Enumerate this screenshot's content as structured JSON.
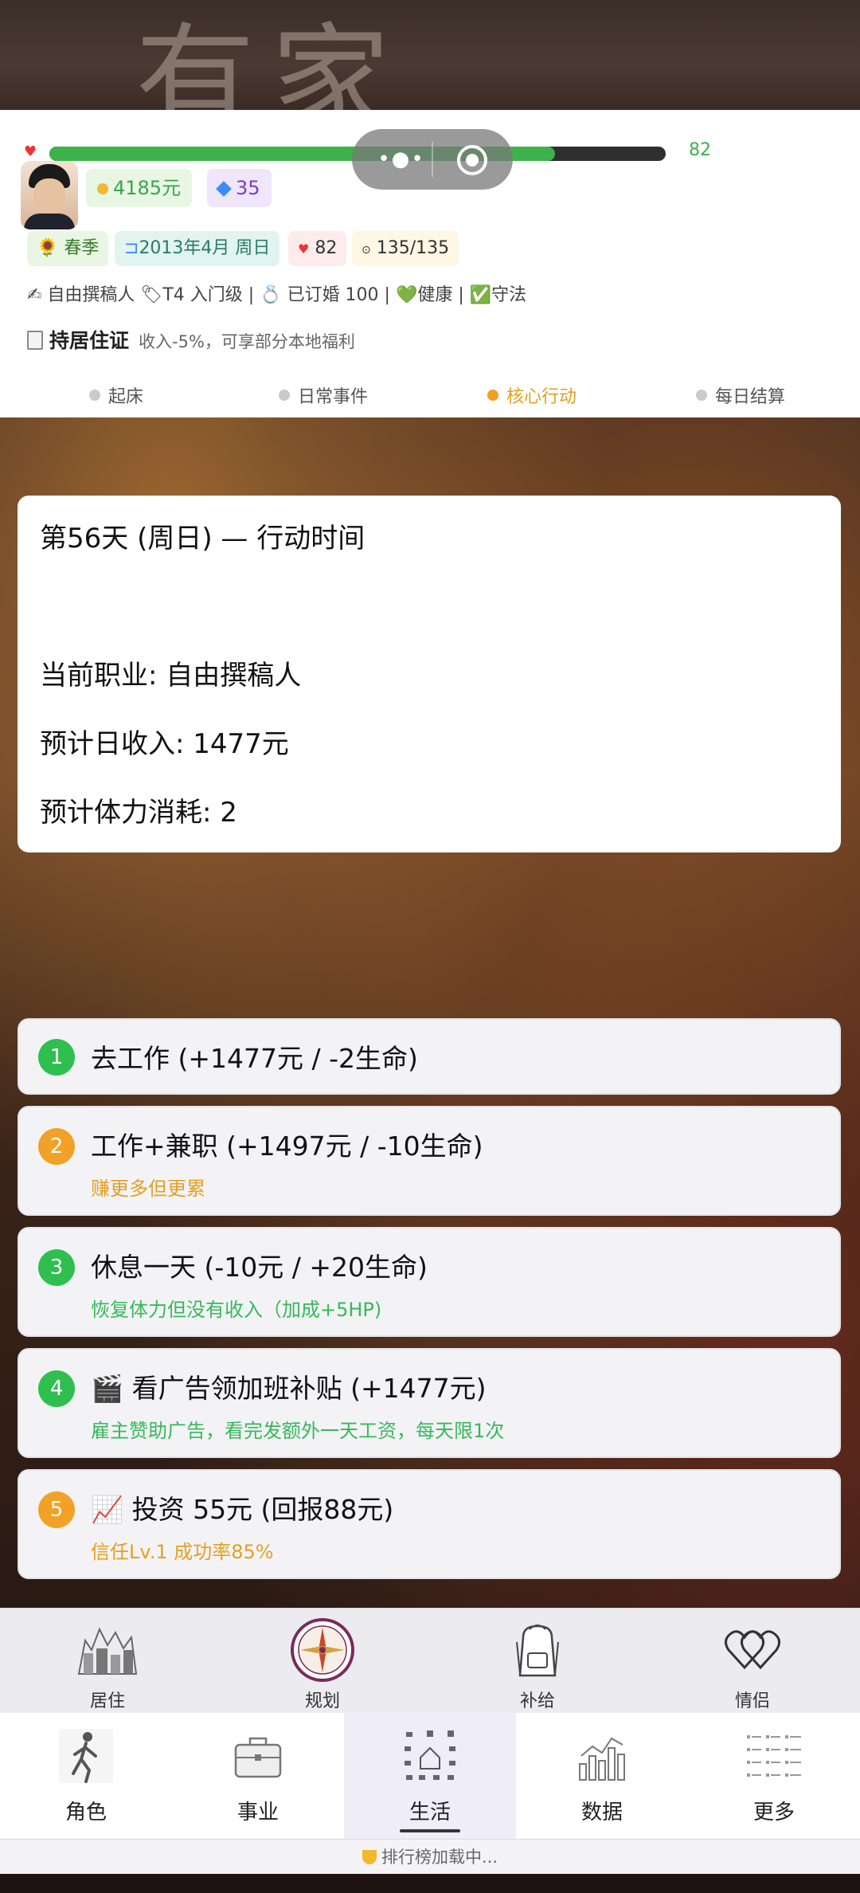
{
  "background": {
    "sign_text": "有家"
  },
  "header": {
    "hp_value": "82",
    "hp_fraction": 0.82,
    "money": "4185元",
    "gems": "35",
    "tags": {
      "season": "🌻 春季",
      "date": "2013年4月 周日",
      "heart": "82",
      "energy": "135/135"
    },
    "info_line": "✍ 自由撰稿人 🏷T4 入门级 | 💍 已订婚 100 | 💚健康 | ✅守法",
    "residence": {
      "label": "持居住证",
      "desc": "收入-5%，可享部分本地福利"
    },
    "steps": [
      {
        "label": "起床",
        "active": false
      },
      {
        "label": "日常事件",
        "active": false
      },
      {
        "label": "核心行动",
        "active": true
      },
      {
        "label": "每日结算",
        "active": false
      }
    ]
  },
  "day_card": {
    "title": "第56天 (周日) — 行动时间",
    "job": "当前职业: 自由撰稿人",
    "income": "预计日收入: 1477元",
    "stamina": "预计体力消耗: 2"
  },
  "options": [
    {
      "num": "1",
      "color": "green",
      "title": "去工作 (+1477元 / -2生命)",
      "sub": ""
    },
    {
      "num": "2",
      "color": "orange",
      "title": "工作+兼职 (+1497元 / -10生命)",
      "sub": "赚更多但更累"
    },
    {
      "num": "3",
      "color": "green",
      "title": "休息一天 (-10元 / +20生命)",
      "sub": "恢复体力但没有收入（加成+5HP)"
    },
    {
      "num": "4",
      "color": "green",
      "title": "🎬 看广告领加班补贴 (+1477元)",
      "sub": "雇主赞助广告，看完发额外一天工资，每天限1次"
    },
    {
      "num": "5",
      "color": "orange",
      "title": "📈 投资 55元 (回报88元)",
      "sub": "信任Lv.1 成功率85%"
    }
  ],
  "subnav": [
    {
      "label": "居住",
      "icon": "city-icon"
    },
    {
      "label": "规划",
      "icon": "compass-icon"
    },
    {
      "label": "补给",
      "icon": "backpack-icon"
    },
    {
      "label": "情侣",
      "icon": "hearts-icon"
    }
  ],
  "mainnav": [
    {
      "label": "角色",
      "icon": "walker-icon",
      "active": false
    },
    {
      "label": "事业",
      "icon": "briefcase-icon",
      "active": false
    },
    {
      "label": "生活",
      "icon": "life-icon",
      "active": true
    },
    {
      "label": "数据",
      "icon": "chart-icon",
      "active": false
    },
    {
      "label": "更多",
      "icon": "list-icon",
      "active": false
    }
  ],
  "rank_bar": "排行榜加载中...",
  "colors": {
    "hp": "#3cb34a",
    "active_step": "#f0a020",
    "green_badge": "#2fbf4f",
    "orange_badge": "#f1a226"
  }
}
